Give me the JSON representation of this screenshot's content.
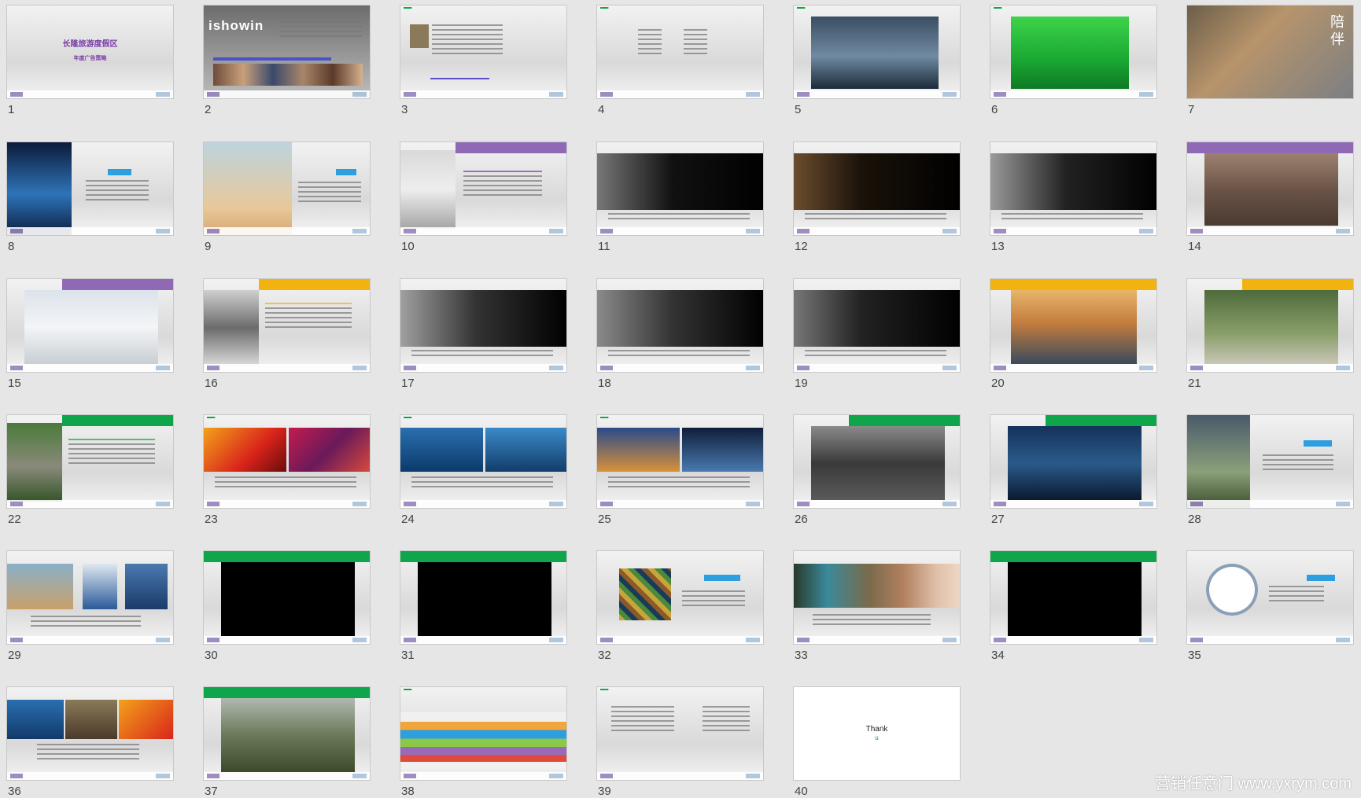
{
  "slides": [
    {
      "num": "1",
      "title": "长隆旅游度假区",
      "subtitle": "年度广告策略"
    },
    {
      "num": "2",
      "brand": "ishowin"
    },
    {
      "num": "3"
    },
    {
      "num": "4"
    },
    {
      "num": "5"
    },
    {
      "num": "6"
    },
    {
      "num": "7",
      "overlay": "陪 伴"
    },
    {
      "num": "8"
    },
    {
      "num": "9"
    },
    {
      "num": "10"
    },
    {
      "num": "11"
    },
    {
      "num": "12"
    },
    {
      "num": "13"
    },
    {
      "num": "14"
    },
    {
      "num": "15"
    },
    {
      "num": "16"
    },
    {
      "num": "17"
    },
    {
      "num": "18"
    },
    {
      "num": "19"
    },
    {
      "num": "20"
    },
    {
      "num": "21"
    },
    {
      "num": "22"
    },
    {
      "num": "23"
    },
    {
      "num": "24"
    },
    {
      "num": "25"
    },
    {
      "num": "26"
    },
    {
      "num": "27"
    },
    {
      "num": "28"
    },
    {
      "num": "29"
    },
    {
      "num": "30"
    },
    {
      "num": "31"
    },
    {
      "num": "32"
    },
    {
      "num": "33"
    },
    {
      "num": "34"
    },
    {
      "num": "35"
    },
    {
      "num": "36"
    },
    {
      "num": "37"
    },
    {
      "num": "38"
    },
    {
      "num": "39"
    },
    {
      "num": "40",
      "thank": "Thank",
      "thank2": "u"
    }
  ],
  "watermark": "营销任意门 www.yxrym.com",
  "colors": {
    "accent_purple": "#8f69b5",
    "accent_yellow": "#f2b20f",
    "accent_green": "#0fa64b",
    "title_purple": "#7a3fa6"
  }
}
